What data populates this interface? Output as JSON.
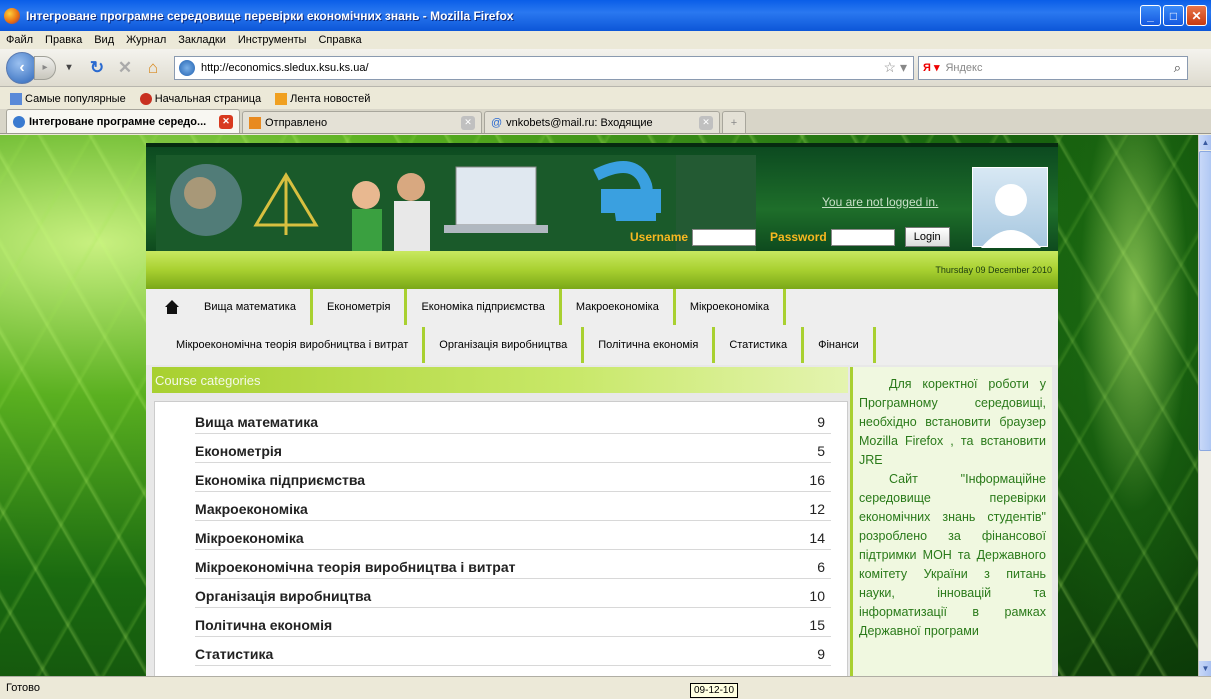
{
  "window": {
    "title": "Інтегроване програмне середовище перевірки економічних знань - Mozilla Firefox"
  },
  "menu": [
    "Файл",
    "Правка",
    "Вид",
    "Журнал",
    "Закладки",
    "Инструменты",
    "Справка"
  ],
  "url": "http://economics.sledux.ksu.ks.ua/",
  "search_placeholder": "Яндекс",
  "bookmarks": [
    "Самые популярные",
    "Начальная страница",
    "Лента новостей"
  ],
  "tabs": [
    "Інтегроване програмне середо...",
    "Отправлено",
    "vnkobets@mail.ru: Входящие"
  ],
  "header": {
    "logged_text": "You are not logged in.",
    "username_label": "Username",
    "password_label": "Password",
    "login_button": "Login",
    "date": "Thursday 09 December 2010"
  },
  "nav_row1": [
    "Вища математика",
    "Економетрія",
    "Економіка підприємства",
    "Макроекономіка",
    "Мікроекономіка"
  ],
  "nav_row2": [
    "Мікроекономічна теорія виробництва і витрат",
    "Організація виробництва",
    "Політична економія",
    "Статистика",
    "Фінанси"
  ],
  "course_categories_title": "Course categories",
  "categories": [
    {
      "name": "Вища математика",
      "count": "9"
    },
    {
      "name": "Економетрія",
      "count": "5"
    },
    {
      "name": "Економіка підприємства",
      "count": "16"
    },
    {
      "name": "Макроекономіка",
      "count": "12"
    },
    {
      "name": "Мікроекономіка",
      "count": "14"
    },
    {
      "name": "Мікроекономічна теорія виробництва і витрат",
      "count": "6"
    },
    {
      "name": "Організація виробництва",
      "count": "10"
    },
    {
      "name": "Політична економія",
      "count": "15"
    },
    {
      "name": "Статистика",
      "count": "9"
    }
  ],
  "sidebar": {
    "p1": "Для коректної роботи у Програмному середовищі, необхідно встановити браузер Mozilla Firefox , та встановити JRE",
    "p2": "Сайт \"Інформаційне середовище перевірки економічних знань студентів\" розроблено за фінансової підтримки МОН та Державного комітету України з питань науки, інновацій та інформатизації в рамках Державної програми"
  },
  "status": {
    "text": "Готово",
    "tooltip": "09-12-10"
  },
  "colors": {
    "accent_green": "#a8d030",
    "header_dark": "#0c4a20",
    "sidebar_text": "#2a7a1a"
  }
}
